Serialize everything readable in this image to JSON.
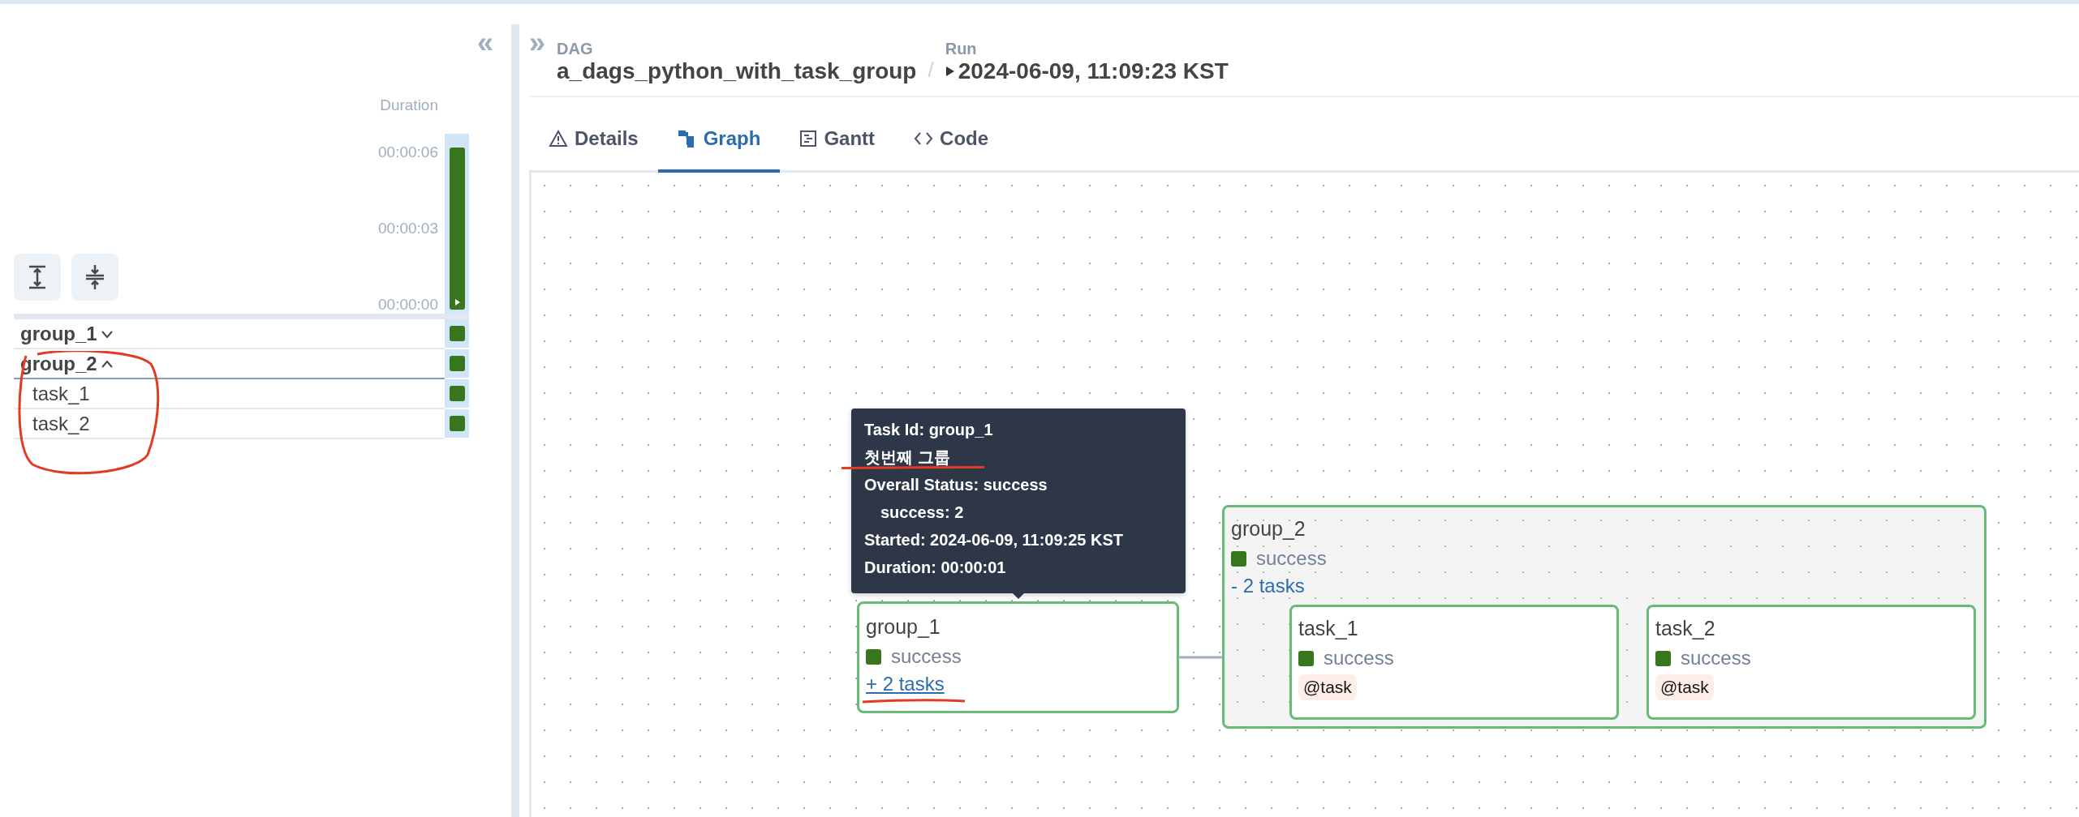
{
  "header": {
    "collapse_symbol": "«",
    "expand_symbol": "»",
    "dag_label": "DAG",
    "dag_name": "a_dags_python_with_task_group",
    "separator": "/",
    "run_label": "Run",
    "run_name": "2024-06-09, 11:09:23 KST"
  },
  "tabs": [
    {
      "label": "Details",
      "kind": "details",
      "selected": false
    },
    {
      "label": "Graph",
      "kind": "graph",
      "selected": true
    },
    {
      "label": "Gantt",
      "kind": "gantt",
      "selected": false
    },
    {
      "label": "Code",
      "kind": "code",
      "selected": false
    }
  ],
  "grid": {
    "duration_label": "Duration",
    "duration_ticks": [
      "00:00:06",
      "00:00:03",
      "00:00:00"
    ],
    "rows": [
      {
        "label": "group_1",
        "kind": "group",
        "expanded": false,
        "color": "#38761d"
      },
      {
        "label": "group_2",
        "kind": "group",
        "expanded": true,
        "color": "#38761d",
        "children": [
          {
            "label": "task_1",
            "kind": "task",
            "color": "#38761d"
          },
          {
            "label": "task_2",
            "kind": "task",
            "color": "#38761d"
          }
        ]
      }
    ]
  },
  "graph": {
    "tooltip": {
      "lines": [
        {
          "text": "Task Id: group_1",
          "kind": "plain"
        },
        {
          "text": "첫번째 그룹",
          "kind": "plain"
        },
        {
          "text": "Overall Status: success",
          "kind": "plain"
        },
        {
          "text": "success: 2",
          "kind": "indented"
        },
        {
          "text": "Started: 2024-06-09, 11:09:25 KST",
          "kind": "plain"
        },
        {
          "text": "Duration: 00:00:01",
          "kind": "plain"
        }
      ]
    },
    "nodes": [
      {
        "kind": "group",
        "name": "group_1",
        "status": "success",
        "toggle": "+ 2 tasks",
        "expanded": false
      },
      {
        "kind": "group",
        "name": "group_2",
        "status": "success",
        "toggle": "- 2 tasks",
        "expanded": true,
        "children": [
          {
            "kind": "task",
            "name": "task_1",
            "status": "success",
            "operator": "@task"
          },
          {
            "kind": "task",
            "name": "task_2",
            "status": "success",
            "operator": "@task"
          }
        ]
      }
    ]
  }
}
